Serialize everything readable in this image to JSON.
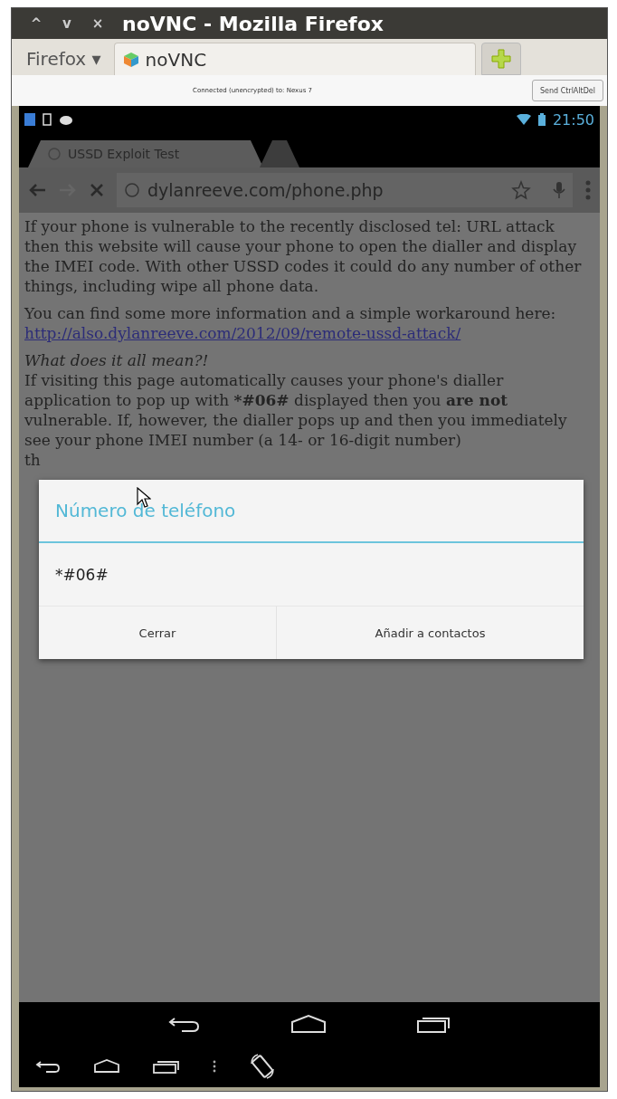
{
  "window": {
    "title": "noVNC - Mozilla Firefox",
    "controls": [
      "^",
      "v",
      "×"
    ]
  },
  "firefox": {
    "menu_label": "Firefox ▾",
    "tabs": [
      {
        "label": "noVNC",
        "selected": true
      }
    ]
  },
  "novnc": {
    "status": "Connected (unencrypted) to: Nexus 7",
    "button": "Send CtrlAltDel"
  },
  "android_status": {
    "time": "21:50"
  },
  "browser": {
    "tabs": [
      {
        "label": "USSD Exploit Test",
        "selected": true
      },
      {
        "selected": false
      }
    ],
    "url": "dylanreeve.com/phone.php"
  },
  "page": {
    "paragraphs": [
      {
        "kind": "text",
        "segments": [
          {
            "text": "If your phone is vulnerable to the recently disclosed tel: URL attack then this website will cause your phone to open the dialler and display the IMEI code. With other USSD codes it could do any number of other things, including wipe all phone data.",
            "bold": false
          }
        ]
      },
      {
        "kind": "text",
        "segments": [
          {
            "text": "You can find some more information and a simple workaround here:",
            "bold": false
          }
        ]
      },
      {
        "kind": "link",
        "segments": [
          {
            "text": "http://also.dylanreeve.com/2012/09/remote-ussd-attack/",
            "bold": false
          }
        ]
      },
      {
        "kind": "heading",
        "segments": [
          {
            "text": "What does it all mean?!",
            "bold": false
          }
        ]
      },
      {
        "kind": "tight",
        "segments": [
          {
            "text": "If visiting this page automatically causes your phone's dialler application to pop up with ",
            "bold": false
          },
          {
            "text": "*#06#",
            "bold": true
          },
          {
            "text": " displayed then you ",
            "bold": false
          },
          {
            "text": "are not",
            "bold": true
          },
          {
            "text": " vulnerable. If, however, the dialler pops up and then you immediately see your phone IMEI number (a 14- or 16-digit number)",
            "bold": false
          }
        ]
      },
      {
        "kind": "tight",
        "segments": [
          {
            "text": "th",
            "bold": false
          }
        ]
      }
    ]
  },
  "dialog": {
    "title": "Número de teléfono",
    "value": "*#06#",
    "buttons": [
      "Cerrar",
      "Añadir a contactos"
    ]
  }
}
